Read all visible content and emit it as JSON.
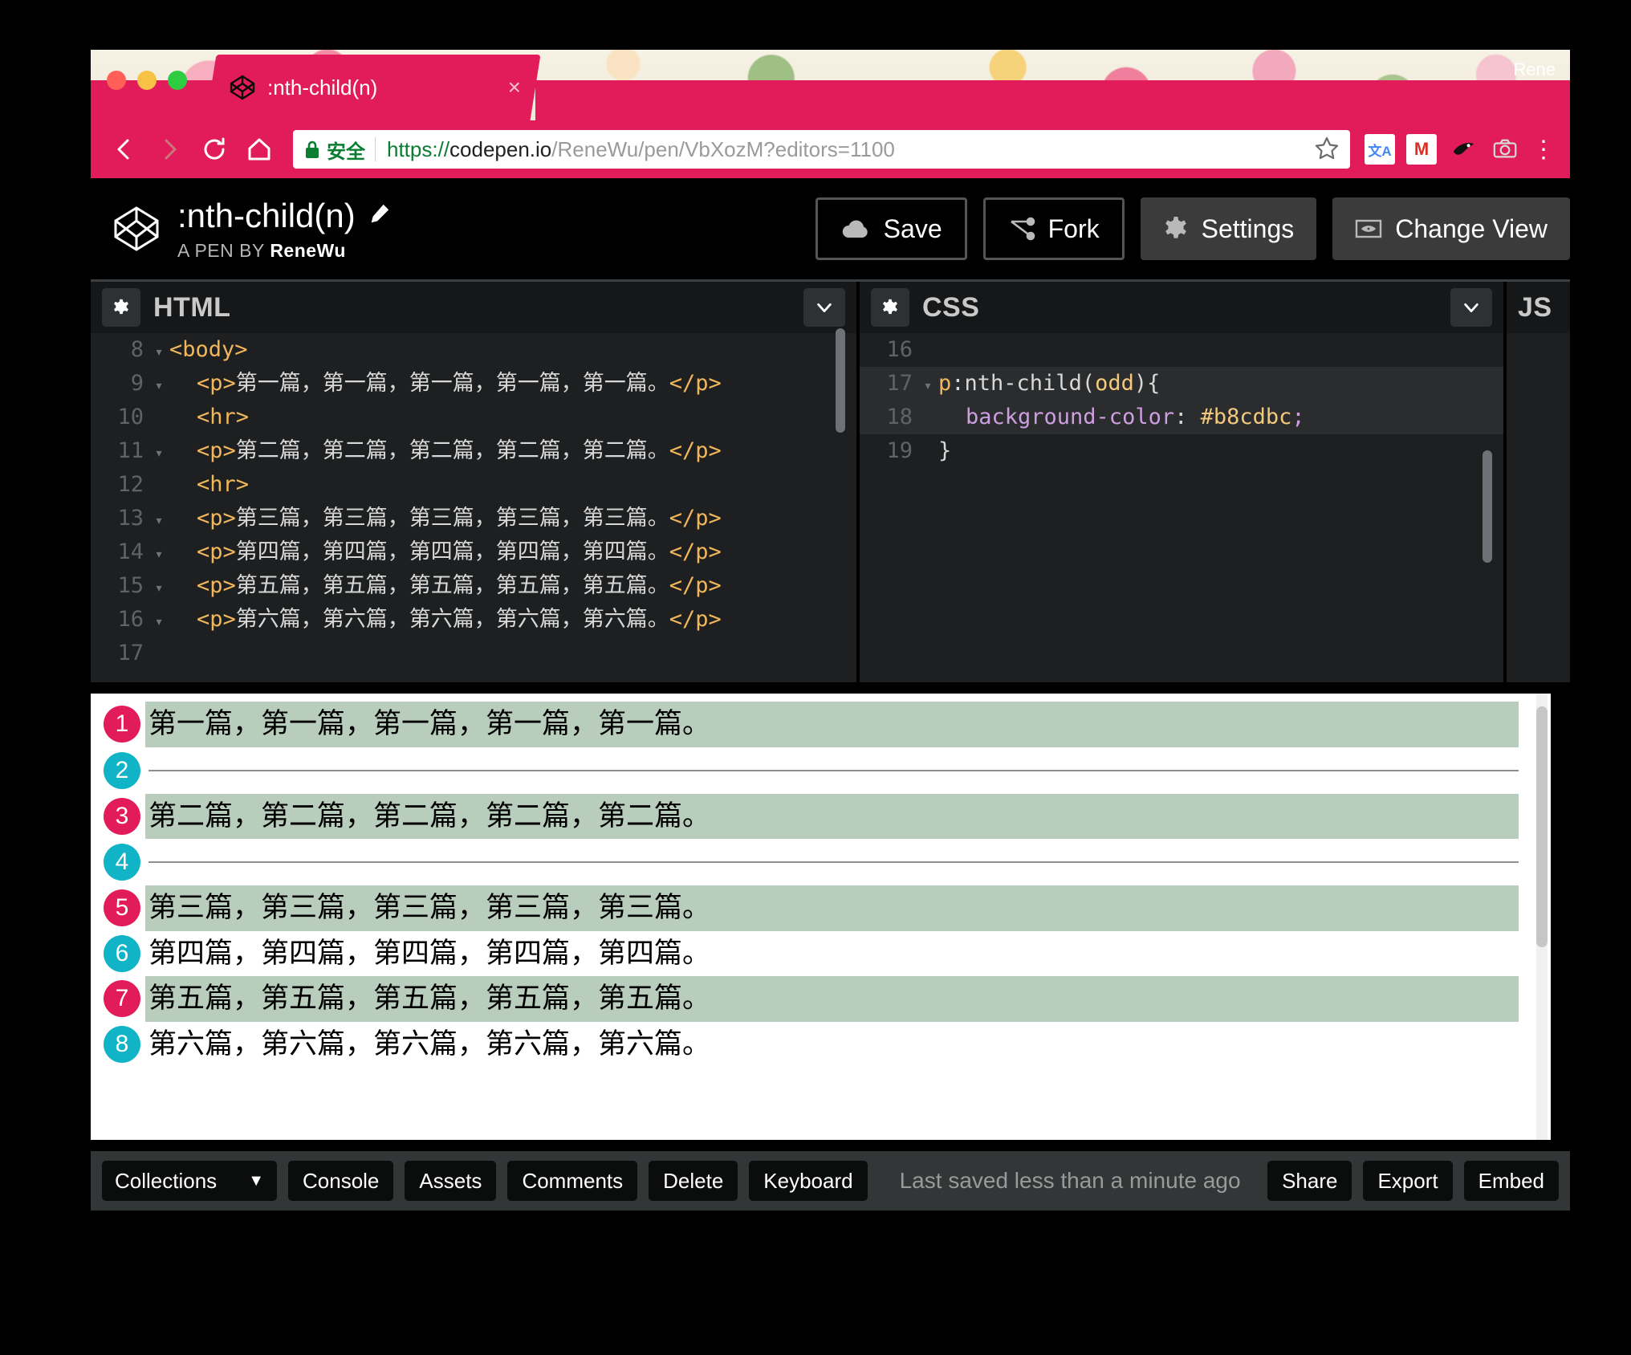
{
  "browser": {
    "tab": {
      "title": ":nth-child(n)",
      "favicon": "codepen-icon",
      "close": "×"
    },
    "profile_name": "Rene",
    "omnibox": {
      "secure_label": "安全",
      "url_scheme": "https://",
      "url_host": "codepen.io",
      "url_path": "/ReneWu/pen/VbXozM?editors=1100",
      "full_url": "https://codepen.io/ReneWu/pen/VbXozM?editors=1100"
    },
    "extensions": [
      "translate-icon",
      "gmail-icon",
      "ninja-icon",
      "camera-icon"
    ],
    "menu": "⋮",
    "accent_color": "#e21b5a"
  },
  "pen": {
    "title": ":nth-child(n)",
    "byline_prefix": "A PEN BY ",
    "author": "ReneWu",
    "actions": [
      {
        "label": "Save",
        "icon": "cloud-icon",
        "style": "outlined"
      },
      {
        "label": "Fork",
        "icon": "fork-icon",
        "style": "outlined"
      },
      {
        "label": "Settings",
        "icon": "gear-icon",
        "style": "filled"
      },
      {
        "label": "Change View",
        "icon": "eye-icon",
        "style": "filled"
      }
    ]
  },
  "editors": {
    "html": {
      "label": "HTML",
      "lines": [
        {
          "n": "8",
          "fold": "▾",
          "indent": 0,
          "parts": [
            {
              "c": "tag",
              "t": "<body>"
            }
          ]
        },
        {
          "n": "9",
          "fold": "▾",
          "indent": 1,
          "parts": [
            {
              "c": "tag",
              "t": "<p>"
            },
            {
              "c": "cjk",
              "t": "第一篇，第一篇，第一篇，第一篇，第一篇。"
            },
            {
              "c": "tag",
              "t": "</p>"
            }
          ]
        },
        {
          "n": "10",
          "fold": "",
          "indent": 1,
          "parts": [
            {
              "c": "tag",
              "t": "<hr>"
            }
          ]
        },
        {
          "n": "11",
          "fold": "▾",
          "indent": 1,
          "parts": [
            {
              "c": "tag",
              "t": "<p>"
            },
            {
              "c": "cjk",
              "t": "第二篇，第二篇，第二篇，第二篇，第二篇。"
            },
            {
              "c": "tag",
              "t": "</p>"
            }
          ]
        },
        {
          "n": "12",
          "fold": "",
          "indent": 1,
          "parts": [
            {
              "c": "tag",
              "t": "<hr>"
            }
          ]
        },
        {
          "n": "13",
          "fold": "▾",
          "indent": 1,
          "parts": [
            {
              "c": "tag",
              "t": "<p>"
            },
            {
              "c": "cjk",
              "t": "第三篇，第三篇，第三篇，第三篇，第三篇。"
            },
            {
              "c": "tag",
              "t": "</p>"
            }
          ]
        },
        {
          "n": "14",
          "fold": "▾",
          "indent": 1,
          "parts": [
            {
              "c": "tag",
              "t": "<p>"
            },
            {
              "c": "cjk",
              "t": "第四篇，第四篇，第四篇，第四篇，第四篇。"
            },
            {
              "c": "tag",
              "t": "</p>"
            }
          ]
        },
        {
          "n": "15",
          "fold": "▾",
          "indent": 1,
          "parts": [
            {
              "c": "tag",
              "t": "<p>"
            },
            {
              "c": "cjk",
              "t": "第五篇，第五篇，第五篇，第五篇，第五篇。"
            },
            {
              "c": "tag",
              "t": "</p>"
            }
          ]
        },
        {
          "n": "16",
          "fold": "▾",
          "indent": 1,
          "parts": [
            {
              "c": "tag",
              "t": "<p>"
            },
            {
              "c": "cjk",
              "t": "第六篇，第六篇，第六篇，第六篇，第六篇。"
            },
            {
              "c": "tag",
              "t": "</p>"
            }
          ]
        },
        {
          "n": "17",
          "fold": "",
          "indent": 1,
          "parts": []
        }
      ]
    },
    "css": {
      "label": "CSS",
      "lines": [
        {
          "n": "16",
          "fold": "",
          "indent": 0,
          "hl": false,
          "parts": []
        },
        {
          "n": "17",
          "fold": "▾",
          "indent": 0,
          "hl": true,
          "parts": [
            {
              "c": "sel",
              "t": "p"
            },
            {
              "c": "plain",
              "t": ":nth-child("
            },
            {
              "c": "val",
              "t": "odd"
            },
            {
              "c": "plain",
              "t": "){"
            }
          ]
        },
        {
          "n": "18",
          "fold": "",
          "indent": 1,
          "hl": true,
          "parts": [
            {
              "c": "prop",
              "t": "background-color"
            },
            {
              "c": "plain",
              "t": ": "
            },
            {
              "c": "val",
              "t": "#b8cdbc"
            },
            {
              "c": "prop",
              "t": ";"
            }
          ]
        },
        {
          "n": "19",
          "fold": "",
          "indent": 0,
          "hl": false,
          "parts": [
            {
              "c": "plain",
              "t": "}"
            }
          ]
        }
      ]
    },
    "js": {
      "label": "JS"
    }
  },
  "preview": {
    "rows": [
      {
        "badge": "1",
        "type": "p",
        "parity": "odd",
        "shaded": true,
        "text": "第一篇，第一篇，第一篇，第一篇，第一篇。"
      },
      {
        "badge": "2",
        "type": "hr",
        "parity": "even",
        "shaded": false,
        "text": ""
      },
      {
        "badge": "3",
        "type": "p",
        "parity": "odd",
        "shaded": true,
        "text": "第二篇，第二篇，第二篇，第二篇，第二篇。"
      },
      {
        "badge": "4",
        "type": "hr",
        "parity": "even",
        "shaded": false,
        "text": ""
      },
      {
        "badge": "5",
        "type": "p",
        "parity": "odd",
        "shaded": true,
        "text": "第三篇，第三篇，第三篇，第三篇，第三篇。"
      },
      {
        "badge": "6",
        "type": "p",
        "parity": "even",
        "shaded": false,
        "text": "第四篇，第四篇，第四篇，第四篇，第四篇。"
      },
      {
        "badge": "7",
        "type": "p",
        "parity": "odd",
        "shaded": true,
        "text": "第五篇，第五篇，第五篇，第五篇，第五篇。"
      },
      {
        "badge": "8",
        "type": "p",
        "parity": "even",
        "shaded": false,
        "text": "第六篇，第六篇，第六篇，第六篇，第六篇。"
      }
    ],
    "highlight_color": "#b8cdbc",
    "badge_odd_color": "#e21b5a",
    "badge_even_color": "#11b3c6"
  },
  "footer": {
    "collections_label": "Collections",
    "collections_caret": "▼",
    "buttons": [
      "Console",
      "Assets",
      "Comments",
      "Delete",
      "Keyboard"
    ],
    "saved_status": "Last saved less than a minute ago",
    "right_buttons": [
      "Share",
      "Export",
      "Embed"
    ]
  }
}
